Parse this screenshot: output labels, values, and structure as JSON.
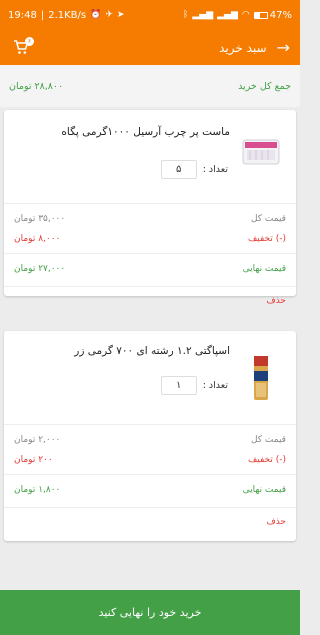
{
  "status_bar": {
    "time": "19:48",
    "network_speed": "2.1KB/s",
    "battery_percent": "47%",
    "battery_level": 0.47
  },
  "app_bar": {
    "title": "سبد خرید",
    "cart_badge": "۶"
  },
  "summary": {
    "total_label": "جمع کل خرید",
    "total_value": "۲۸,۸۰۰ تومان"
  },
  "items": [
    {
      "name": "ماست پر چرب آرسیل ۱۰۰۰گرمی پگاه",
      "qty_label": "تعداد :",
      "qty": "۵",
      "price_label": "قیمت کل",
      "price": "۳۵,۰۰۰ تومان",
      "discount_label": "(-) تخفیف",
      "discount": "۸,۰۰۰ تومان",
      "final_label": "قیمت نهایی",
      "final": "۲۷,۰۰۰ تومان",
      "delete": "حذف"
    },
    {
      "name": "اسپاگتی ۱.۲ رشته ای ۷۰۰ گرمی زر",
      "qty_label": "تعداد :",
      "qty": "۱",
      "price_label": "قیمت کل",
      "price": "۲,۰۰۰ تومان",
      "discount_label": "(-) تخفیف",
      "discount": "۲۰۰ تومان",
      "final_label": "قیمت نهایی",
      "final": "۱,۸۰۰ تومان",
      "delete": "حذف"
    }
  ],
  "checkout_label": "خرید خود را نهایی کنید",
  "colors": {
    "primary": "#f57c00",
    "green": "#43a047",
    "red": "#e53935"
  }
}
